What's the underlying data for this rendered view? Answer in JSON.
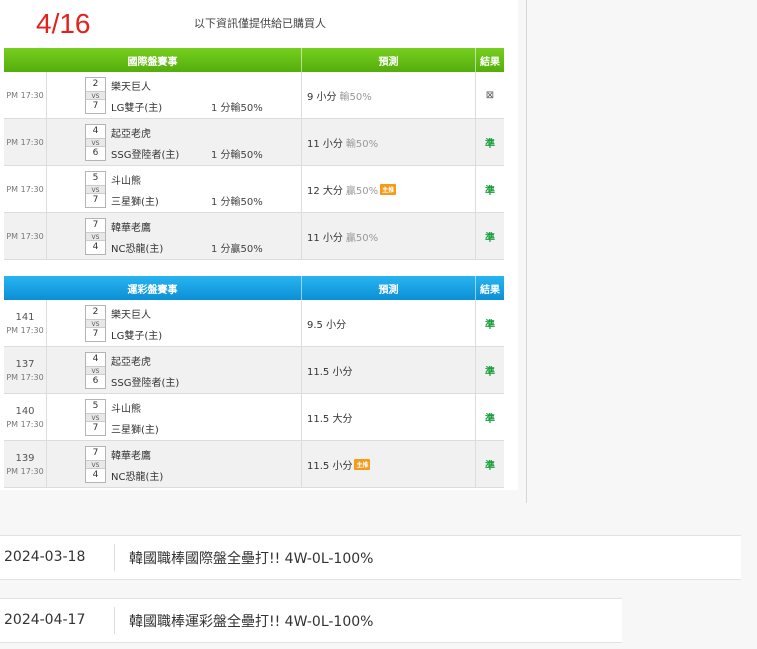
{
  "header": {
    "date": "4/16",
    "notice": "以下資訊僅提供給已購買人"
  },
  "international": {
    "title": "國際盤賽事",
    "pred_header": "預測",
    "result_header": "結果",
    "rows": [
      {
        "time": "PM 17:30",
        "away_score": "2",
        "home_score": "7",
        "away": "樂天巨人",
        "home": "LG雙子(主)",
        "line": "1 分輸50%",
        "pred": "9 小分",
        "odds": "輸50%",
        "hot": "",
        "result": "⊠"
      },
      {
        "time": "PM 17:30",
        "away_score": "4",
        "home_score": "6",
        "away": "起亞老虎",
        "home": "SSG登陸者(主)",
        "line": "1 分輸50%",
        "pred": "11 小分",
        "odds": "輸50%",
        "hot": "",
        "result": "準"
      },
      {
        "time": "PM 17:30",
        "away_score": "5",
        "home_score": "7",
        "away": "斗山熊",
        "home": "三星獅(主)",
        "line": "1 分輸50%",
        "pred": "12 大分",
        "odds": "贏50%",
        "hot": "主推",
        "result": "準"
      },
      {
        "time": "PM 17:30",
        "away_score": "7",
        "home_score": "4",
        "away": "韓華老鷹",
        "home": "NC恐龍(主)",
        "line": "1 分贏50%",
        "pred": "11 小分",
        "odds": "贏50%",
        "hot": "",
        "result": "準"
      }
    ]
  },
  "lottery": {
    "title": "運彩盤賽事",
    "pred_header": "預測",
    "result_header": "結果",
    "rows": [
      {
        "num": "141",
        "time": "PM 17:30",
        "away_score": "2",
        "home_score": "7",
        "away": "樂天巨人",
        "home": "LG雙子(主)",
        "pred": "9.5 小分",
        "hot": "",
        "result": "準"
      },
      {
        "num": "137",
        "time": "PM 17:30",
        "away_score": "4",
        "home_score": "6",
        "away": "起亞老虎",
        "home": "SSG登陸者(主)",
        "pred": "11.5 小分",
        "hot": "",
        "result": "準"
      },
      {
        "num": "140",
        "time": "PM 17:30",
        "away_score": "5",
        "home_score": "7",
        "away": "斗山熊",
        "home": "三星獅(主)",
        "pred": "11.5 大分",
        "hot": "",
        "result": "準"
      },
      {
        "num": "139",
        "time": "PM 17:30",
        "away_score": "7",
        "home_score": "4",
        "away": "韓華老鷹",
        "home": "NC恐龍(主)",
        "pred": "11.5 小分",
        "hot": "主推",
        "result": "準"
      }
    ]
  },
  "vs_label": "VS",
  "summaries": [
    {
      "date": "2024-03-18",
      "text": "韓國職棒國際盤全壘打!! 4W-0L-100%"
    },
    {
      "date": "2024-04-17",
      "text": "韓國職棒運彩盤全壘打!! 4W-0L-100%"
    }
  ]
}
